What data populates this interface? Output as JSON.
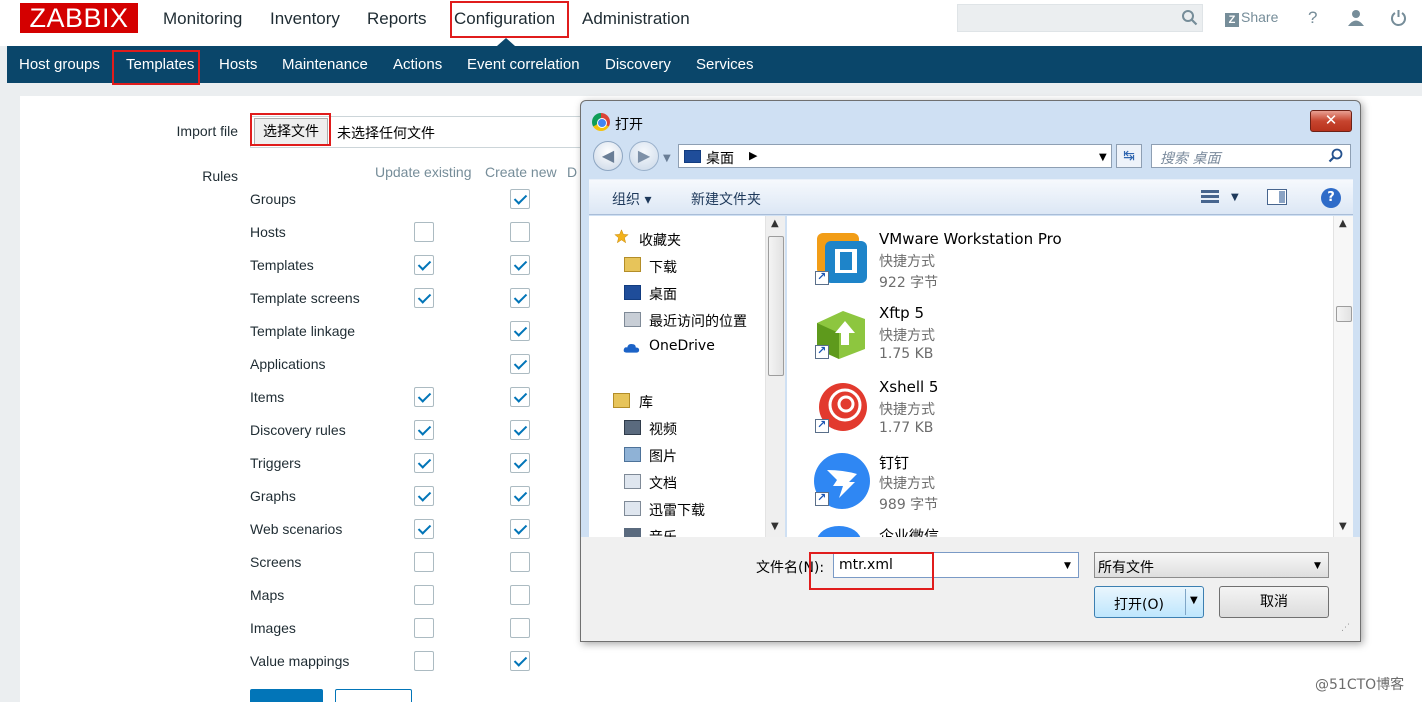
{
  "app": {
    "logo": "ZABBIX",
    "main_nav": [
      "Monitoring",
      "Inventory",
      "Reports",
      "Configuration",
      "Administration"
    ],
    "share": "Share",
    "help_glyph": "?",
    "sub_nav": [
      "Host groups",
      "Templates",
      "Hosts",
      "Maintenance",
      "Actions",
      "Event correlation",
      "Discovery",
      "Services"
    ]
  },
  "form": {
    "import_file_label": "Import file",
    "choose_file_btn": "选择文件",
    "no_file_text": "未选择任何文件",
    "rules_label": "Rules",
    "columns": [
      "Update existing",
      "Create new",
      "D"
    ],
    "rules": [
      {
        "label": "Groups",
        "update": null,
        "create": true
      },
      {
        "label": "Hosts",
        "update": false,
        "create": false
      },
      {
        "label": "Templates",
        "update": true,
        "create": true
      },
      {
        "label": "Template screens",
        "update": true,
        "create": true
      },
      {
        "label": "Template linkage",
        "update": null,
        "create": true
      },
      {
        "label": "Applications",
        "update": null,
        "create": true
      },
      {
        "label": "Items",
        "update": true,
        "create": true
      },
      {
        "label": "Discovery rules",
        "update": true,
        "create": true
      },
      {
        "label": "Triggers",
        "update": true,
        "create": true
      },
      {
        "label": "Graphs",
        "update": true,
        "create": true
      },
      {
        "label": "Web scenarios",
        "update": true,
        "create": true
      },
      {
        "label": "Screens",
        "update": false,
        "create": false
      },
      {
        "label": "Maps",
        "update": false,
        "create": false
      },
      {
        "label": "Images",
        "update": false,
        "create": false
      },
      {
        "label": "Value mappings",
        "update": false,
        "create": true
      }
    ]
  },
  "dialog": {
    "title": "打开",
    "close": "✕",
    "address": "桌面",
    "search_placeholder": "搜索 桌面",
    "organize": "组织 ▾",
    "new_folder": "新建文件夹",
    "nav": {
      "favorites": "收藏夹",
      "downloads": "下载",
      "desktop": "桌面",
      "recent": "最近访问的位置",
      "onedrive": "OneDrive",
      "library": "库",
      "videos": "视频",
      "pictures": "图片",
      "documents": "文档",
      "xunlei": "迅雷下载",
      "music": "音乐"
    },
    "files": [
      {
        "name": "VMware Workstation Pro",
        "type": "快捷方式",
        "size": "922 字节"
      },
      {
        "name": "Xftp 5",
        "type": "快捷方式",
        "size": "1.75 KB"
      },
      {
        "name": "Xshell 5",
        "type": "快捷方式",
        "size": "1.77 KB"
      },
      {
        "name": "钉钉",
        "type": "快捷方式",
        "size": "989 字节"
      },
      {
        "name": "企业微信",
        "type": "",
        "size": ""
      }
    ],
    "filename_label": "文件名(N):",
    "filename_value": "mtr.xml",
    "filetype": "所有文件",
    "open_btn": "打开(O)",
    "cancel_btn": "取消"
  },
  "watermark": "@51CTO博客",
  "colors": {
    "brand": "#d40000",
    "nav_bg": "#0a466a",
    "check": "#0275b8",
    "highlight": "#e01c1c"
  }
}
